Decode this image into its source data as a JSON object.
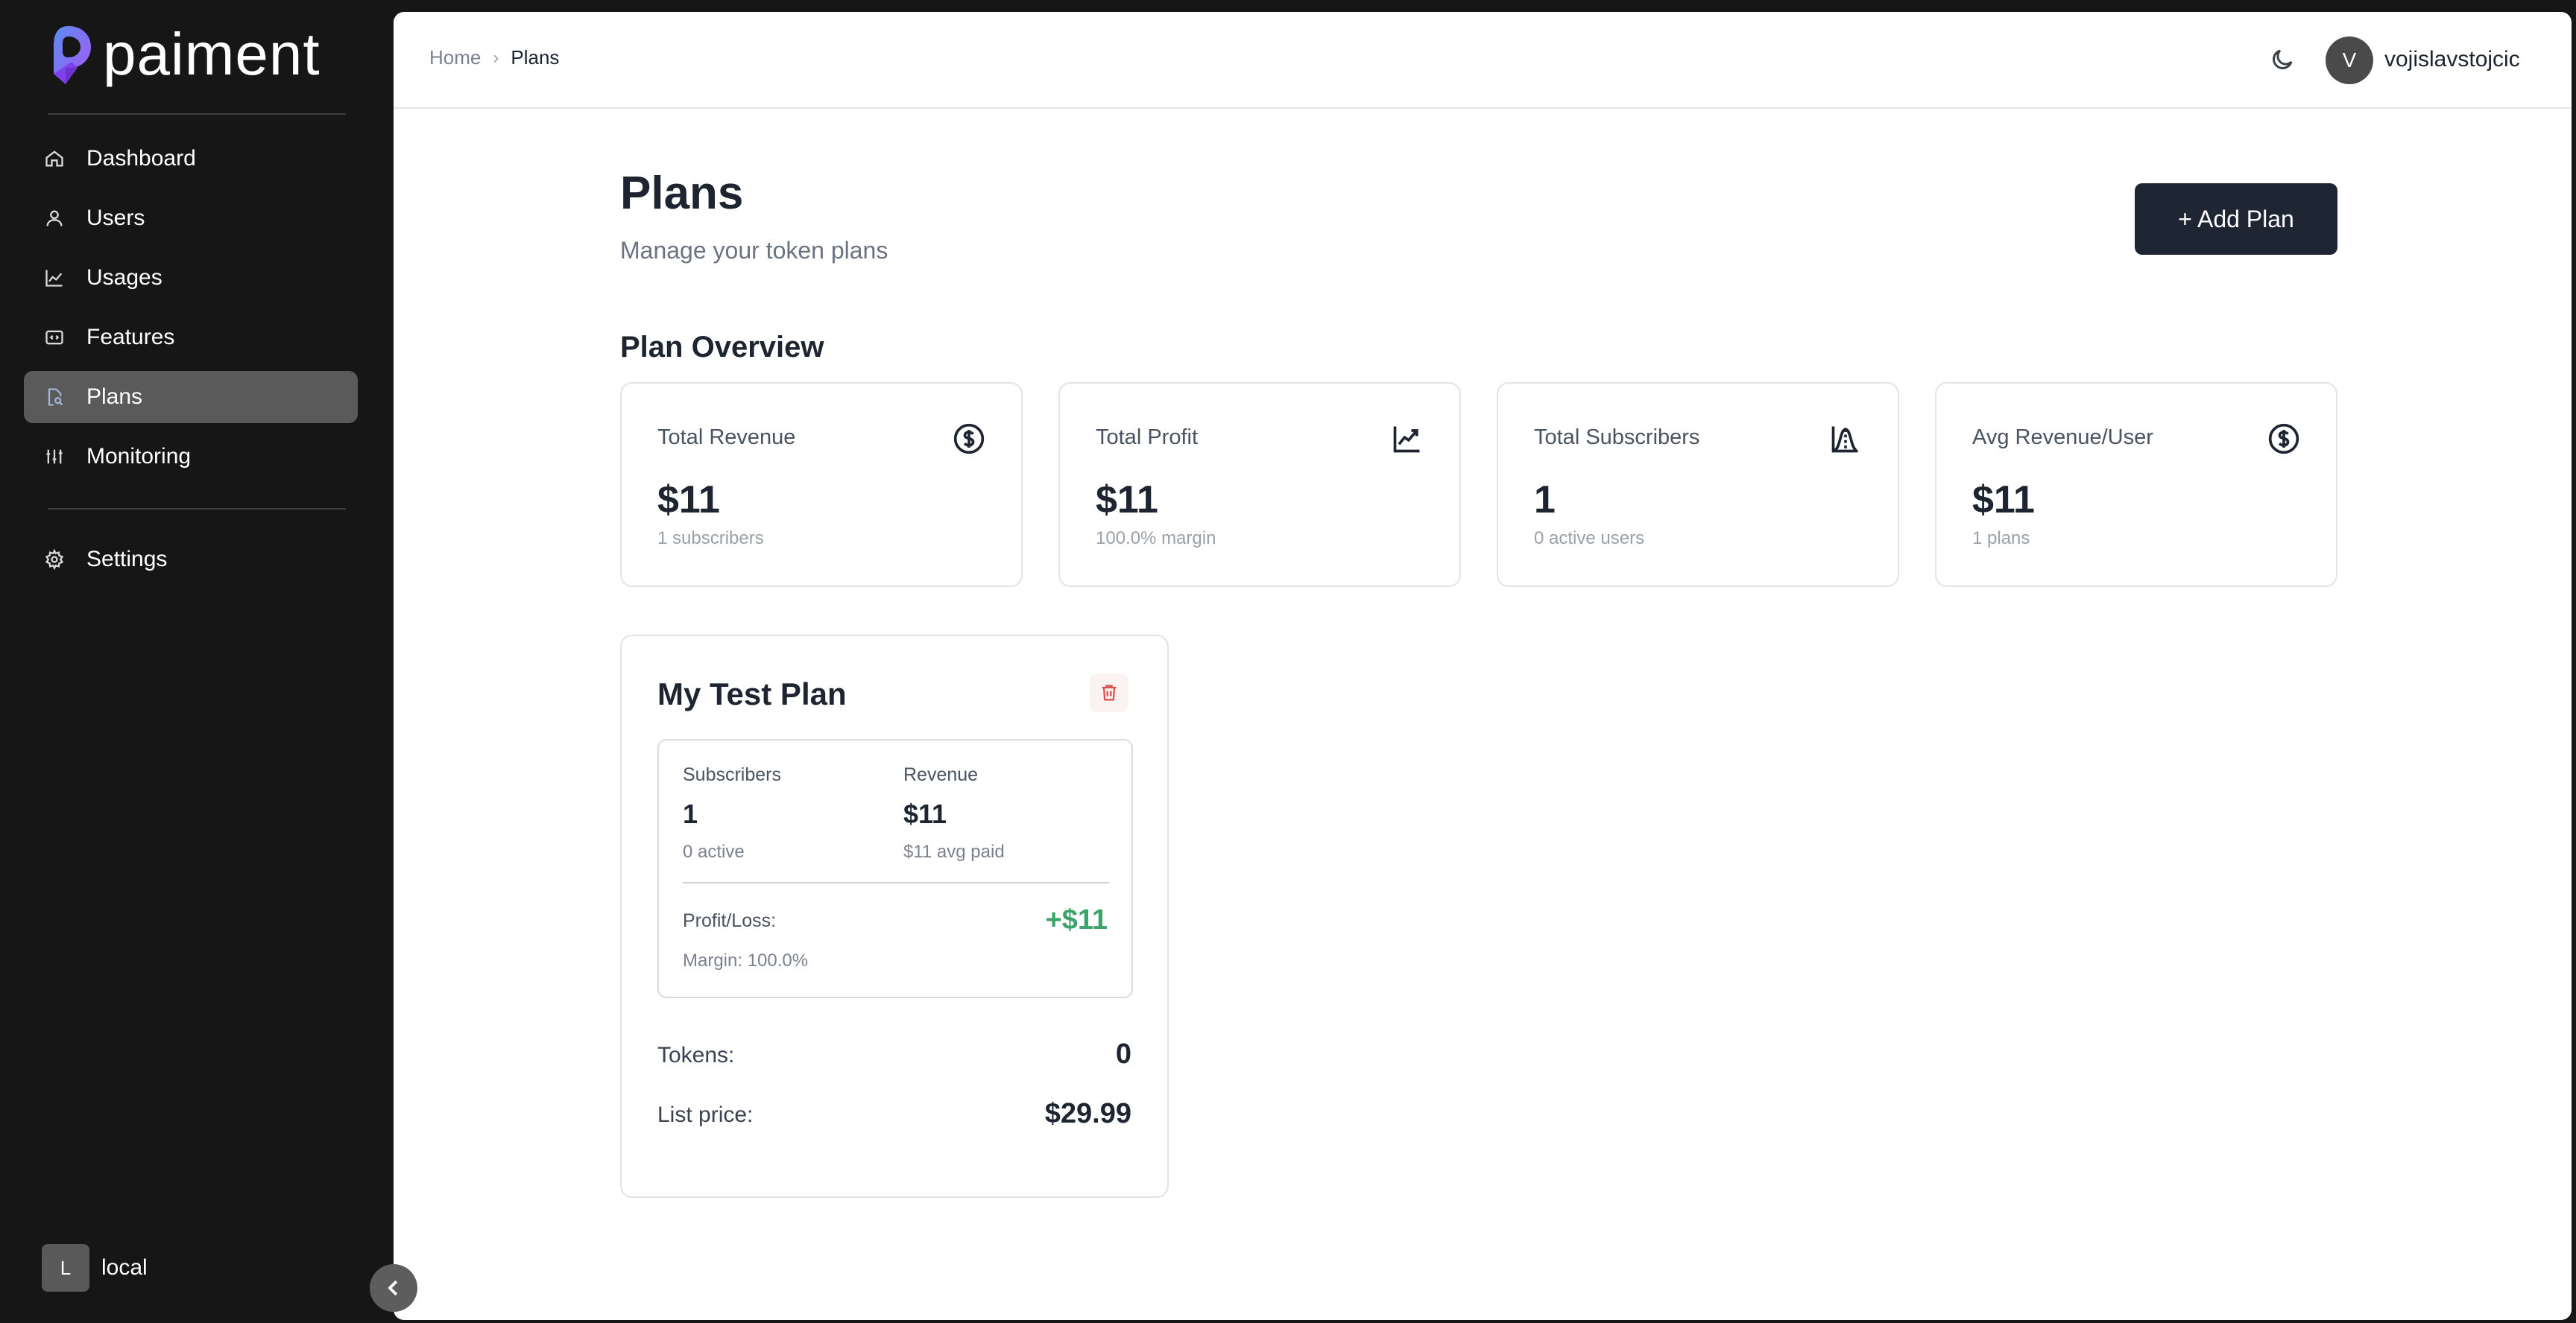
{
  "brand": {
    "name": "paiment",
    "accent": "#8b5cf6"
  },
  "sidebar": {
    "items": [
      {
        "label": "Dashboard",
        "icon": "home-icon"
      },
      {
        "label": "Users",
        "icon": "user-icon"
      },
      {
        "label": "Usages",
        "icon": "chart-line-icon"
      },
      {
        "label": "Features",
        "icon": "code-box-icon"
      },
      {
        "label": "Plans",
        "icon": "file-search-icon",
        "active": true
      },
      {
        "label": "Monitoring",
        "icon": "sliders-icon"
      },
      {
        "label": "Settings",
        "icon": "gear-icon"
      }
    ],
    "workspace": {
      "initial": "L",
      "name": "local"
    }
  },
  "header": {
    "breadcrumb": {
      "home": "Home",
      "separator": "›",
      "current": "Plans"
    },
    "user": {
      "initial": "V",
      "name": "vojislavstojcic"
    }
  },
  "page": {
    "title": "Plans",
    "subtitle": "Manage your token plans",
    "add_button": "+ Add Plan",
    "overview_title": "Plan Overview"
  },
  "stats": [
    {
      "title": "Total Revenue",
      "value": "$11",
      "sub": "1 subscribers",
      "icon": "dollar-circle-icon"
    },
    {
      "title": "Total Profit",
      "value": "$11",
      "sub": "100.0% margin",
      "icon": "trending-up-icon"
    },
    {
      "title": "Total Subscribers",
      "value": "1",
      "sub": "0 active users",
      "icon": "bell-curve-icon"
    },
    {
      "title": "Avg Revenue/User",
      "value": "$11",
      "sub": "1 plans",
      "icon": "dollar-circle-icon"
    }
  ],
  "plan": {
    "name": "My Test Plan",
    "subscribers_label": "Subscribers",
    "subscribers_value": "1",
    "subscribers_sub": "0 active",
    "revenue_label": "Revenue",
    "revenue_value": "$11",
    "revenue_sub": "$11 avg paid",
    "profit_label": "Profit/Loss:",
    "profit_value": "+$11",
    "margin": "Margin: 100.0%",
    "tokens_label": "Tokens:",
    "tokens_value": "0",
    "price_label": "List price:",
    "price_value": "$29.99",
    "profit_color": "#3aa56a"
  }
}
